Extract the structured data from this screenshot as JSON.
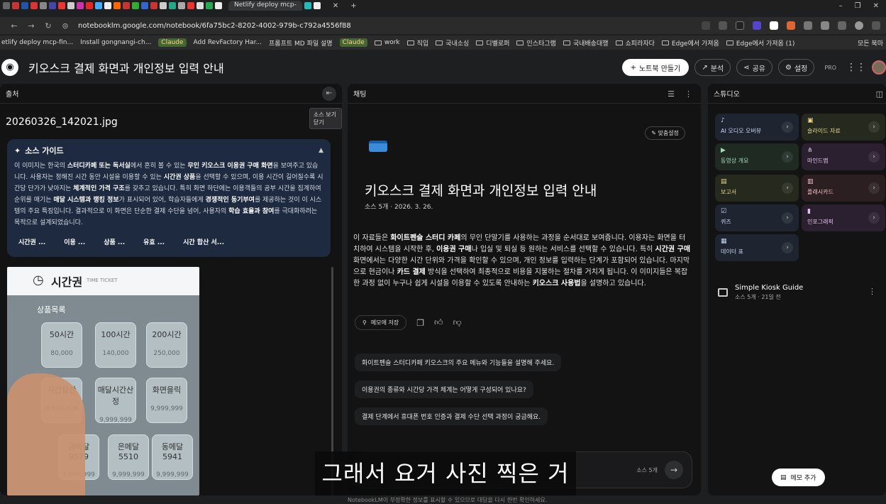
{
  "browser": {
    "active_tab": "Netlify deploy mcp-",
    "url": "notebooklm.google.com/notebook/6fa75bc2-8202-4002-979b-c792a4556f88",
    "bookmarks": [
      {
        "label": "etlify deploy mcp-fin...",
        "kind": "page"
      },
      {
        "label": "Install gongnangi-ch...",
        "kind": "page"
      },
      {
        "label": "Claude",
        "kind": "chip"
      },
      {
        "label": "Add RevFactory Har...",
        "kind": "page"
      },
      {
        "label": "프롬프트 MD 파일 설명",
        "kind": "page"
      },
      {
        "label": "Claude",
        "kind": "chip"
      },
      {
        "label": "work",
        "kind": "folder"
      },
      {
        "label": "직입",
        "kind": "folder"
      },
      {
        "label": "국내소싱",
        "kind": "folder"
      },
      {
        "label": "디벨로퍼",
        "kind": "folder"
      },
      {
        "label": "인스타그램",
        "kind": "folder"
      },
      {
        "label": "국내배송대행",
        "kind": "folder"
      },
      {
        "label": "쇼피라자다",
        "kind": "folder"
      },
      {
        "label": "Edge에서 가져옴",
        "kind": "folder"
      },
      {
        "label": "Edge에서 가져옴 (1)",
        "kind": "folder"
      }
    ],
    "all_bookmarks": "모든 북마"
  },
  "header": {
    "title": "키오스크 결제 화면과 개인정보 입력 안내",
    "create_notebook": "노트북 만들기",
    "analytics": "분석",
    "share": "공유",
    "settings": "설정",
    "pro": "PRO"
  },
  "sources": {
    "heading": "출처",
    "tooltip": "소스 보기 닫기",
    "filename": "20260326_142021.jpg",
    "guide_title": "소스 가이드",
    "guide_segments": [
      [
        "이 이미지는 한국의 ",
        false
      ],
      [
        "스터디카페 또는 독서실",
        true
      ],
      [
        "에서 흔히 볼 수 있는 ",
        false
      ],
      [
        "무인 키오스크 이용권 구매 화면",
        true
      ],
      [
        "을 보여주고 있습니다. 사용자는 정해진 시간 동안 시설을 이용할 수 있는 ",
        false
      ],
      [
        "시간권 상품",
        true
      ],
      [
        "을 선택할 수 있으며, 이용 시간이 길어질수록 시간당 단가가 낮아지는 ",
        false
      ],
      [
        "체계적인 가격 구조",
        true
      ],
      [
        "를 갖추고 있습니다. 특히 화면 하단에는 이용객들의 공부 시간을 집계하여 순위를 매기는 ",
        false
      ],
      [
        "매달 시스템과 랭킹 정보",
        true
      ],
      [
        "가 표시되어 있어, 학습자들에게 ",
        false
      ],
      [
        "경쟁적인 동기부여",
        true
      ],
      [
        "를 제공하는 것이 이 시스템의 주요 특징입니다. 결과적으로 이 화면은 단순한 결제 수단을 넘어, 사용자의 ",
        false
      ],
      [
        "학습 효율과 참여",
        true
      ],
      [
        "를 극대화하려는 목적으로 설계되었습니다.",
        false
      ]
    ],
    "guide_chips": [
      "시간권 ...",
      "이용 ...",
      "상품 ...",
      "유효 ...",
      "시간 합산 서..."
    ],
    "photo": {
      "header_title": "시간권",
      "header_sub": "TIME TICKET",
      "list_label": "상품목록",
      "tiles": [
        {
          "name": "50시간",
          "price": "80,000"
        },
        {
          "name": "100시간",
          "price": "140,000"
        },
        {
          "name": "200시간",
          "price": "250,000"
        },
        {
          "name": "시간합산",
          "price": "9,999,999"
        },
        {
          "name": "매달시간산정",
          "price": "9,999,999"
        },
        {
          "name": "화면을릭",
          "price": "9,999,999"
        },
        {
          "name": "금메달 9579",
          "price": "9,999,999"
        },
        {
          "name": "은메달 5510",
          "price": "9,999,999"
        },
        {
          "name": "동메달 5941",
          "price": "9,999,999"
        }
      ]
    }
  },
  "chat": {
    "heading": "채팅",
    "customize": "맞춤설정",
    "title": "키오스크 결제 화면과 개인정보 입력 안내",
    "meta": "소스 5개 · 2026. 3. 26.",
    "summary_segments": [
      [
        "이 자료들은 ",
        false
      ],
      [
        "화이트펜슬 스터디 카페",
        true
      ],
      [
        "의 무인 단말기를 사용하는 과정을 순서대로 보여줍니다. 이용자는 화면을 터치하여 시스템을 시작한 후, ",
        false
      ],
      [
        "이용권 구매",
        true
      ],
      [
        "나 입실 및 퇴실 등 원하는 서비스를 선택할 수 있습니다. 특히 ",
        false
      ],
      [
        "시간권 구매",
        true
      ],
      [
        " 화면에서는 다양한 시간 단위와 가격을 확인할 수 있으며, 개인 정보를 입력하는 단계가 포함되어 있습니다. 마지막으로 현금이나 ",
        false
      ],
      [
        "카드 결제",
        true
      ],
      [
        " 방식을 선택하여 최종적으로 비용을 지불하는 절차를 거치게 됩니다. 이 이미지들은 복잡한 과정 없이 누구나 쉽게 시설을 이용할 수 있도록 안내하는 ",
        false
      ],
      [
        "키오스크 사용법",
        true
      ],
      [
        "을 설명하고 있습니다.",
        false
      ]
    ],
    "save_note": "메모에 저장",
    "suggestions": [
      "화이트펜슬 스터디카페 키오스크의 주요 메뉴와 기능들을 설명해 주세요.",
      "이용권의 종류와 시간당 가격 체계는 어떻게 구성되어 있나요?",
      "결제 단계에서 휴대폰 번호 인증과 결제 수단 선택 과정이 궁금해요."
    ],
    "input_source_count": "소스 5개",
    "disclaimer": "NotebookLM이 부정확한 정보를 표시할 수 있으므로 대답을 다시 한번 확인하세요."
  },
  "studio": {
    "heading": "스튜디오",
    "tiles": [
      {
        "label": "AI 오디오 오버뷰",
        "color": "#1f2530",
        "text": "#c8d4f0"
      },
      {
        "label": "슬라이드 자료",
        "color": "#262a1e",
        "text": "#e8d890"
      },
      {
        "label": "동영상 개요",
        "color": "#1f2a23",
        "text": "#a8dcb6"
      },
      {
        "label": "마인드맵",
        "color": "#2a2030",
        "text": "#e4c4ee"
      },
      {
        "label": "보고서",
        "color": "#262a1e",
        "text": "#e8d890"
      },
      {
        "label": "플래시카드",
        "color": "#2b1f22",
        "text": "#f0c0c6"
      },
      {
        "label": "퀴즈",
        "color": "#1f2530",
        "text": "#c8d4f0"
      },
      {
        "label": "인포그래픽",
        "color": "#2a2030",
        "text": "#e4c4ee"
      },
      {
        "label": "데이터 표",
        "color": "#1f2530",
        "text": "#c8d4f0"
      }
    ],
    "generated_title": "Simple Kiosk Guide",
    "generated_meta": "소스 5개 · 21일 전",
    "add_memo": "메모 추가"
  },
  "caption": "그래서 요거 사진 찍은 거"
}
